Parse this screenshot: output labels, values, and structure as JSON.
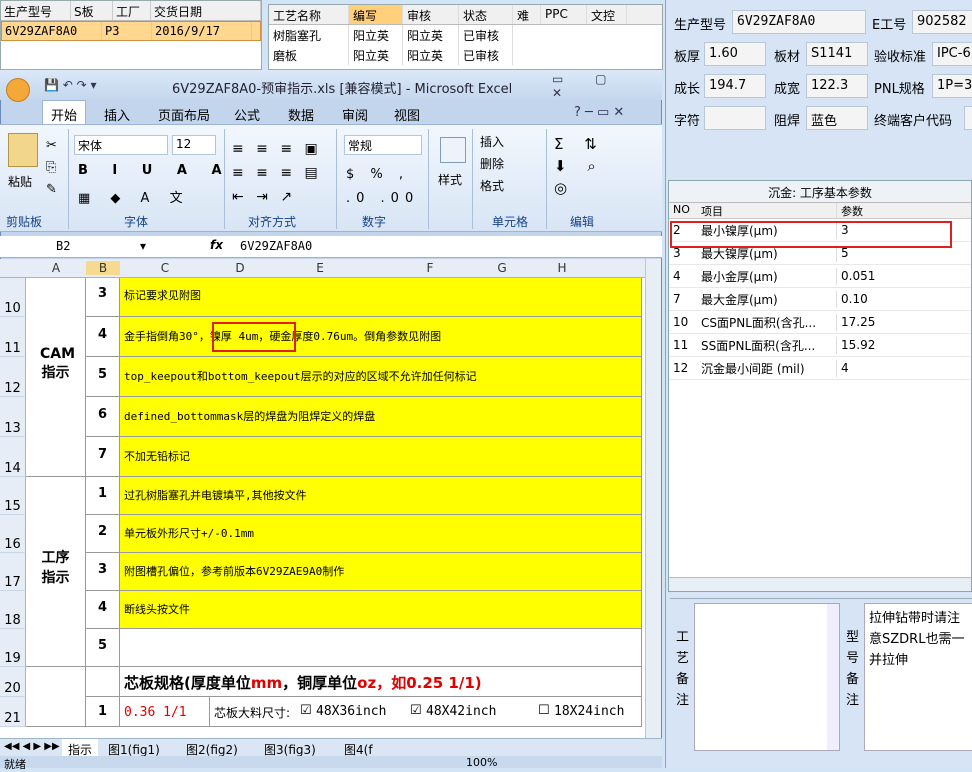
{
  "top_left": {
    "headers": [
      "生产型号",
      "S板",
      "工厂",
      "交货日期"
    ],
    "row": [
      "6V29ZAF8A0",
      "P3",
      "2016/9/17"
    ]
  },
  "top_mid": {
    "headers": [
      "工艺名称",
      "编写",
      "审核",
      "状态",
      "难",
      "PPC",
      "文控"
    ],
    "rows": [
      [
        "树脂塞孔",
        "阳立英",
        "阳立英",
        "已审核"
      ],
      [
        "磨板",
        "阳立英",
        "阳立英",
        "已审核"
      ]
    ]
  },
  "right": {
    "labels": {
      "model": "生产型号",
      "e": "E工号",
      "thick": "板厚",
      "mat": "板材",
      "std": "验收标准",
      "len": "成长",
      "wid": "成宽",
      "pnl": "PNL规格",
      "char": "字符",
      "mask": "阻焊",
      "cust": "终端客户代码"
    },
    "values": {
      "model": "6V29ZAF8A0",
      "e": "902582",
      "thick": "1.60",
      "mat": "S1141",
      "std": "IPC-6",
      "len": "194.7",
      "wid": "122.3",
      "pnl": "1P=3",
      "char": "",
      "mask": "蓝色",
      "cust": ""
    },
    "param_title": "沉金: 工序基本参数",
    "param_headers": [
      "NO",
      "项目",
      "参数"
    ],
    "params": [
      [
        "2",
        "最小镍厚(μm)",
        "3"
      ],
      [
        "3",
        "最大镍厚(μm)",
        "5"
      ],
      [
        "4",
        "最小金厚(μm)",
        "0.051"
      ],
      [
        "7",
        "最大金厚(μm)",
        "0.10"
      ],
      [
        "10",
        "CS面PNL面积(含孔...",
        "17.25"
      ],
      [
        "11",
        "SS面PNL面积(含孔...",
        "15.92"
      ],
      [
        "12",
        "沉金最小间距 (mil)",
        "4"
      ]
    ],
    "craft_note_label": "工艺备注",
    "model_note_label": "型号备注",
    "model_note": "拉伸钻带时请注意SZDRL也需一并拉伸"
  },
  "excel": {
    "title": "6V29ZAF8A0-预审指示.xls [兼容模式] - Microsoft Excel",
    "tabs": [
      "开始",
      "插入",
      "页面布局",
      "公式",
      "数据",
      "审阅",
      "视图"
    ],
    "font_name": "宋体",
    "font_size": "12",
    "number_format": "常规",
    "groups": [
      "剪贴板",
      "字体",
      "对齐方式",
      "数字",
      "样式",
      "单元格",
      "编辑"
    ],
    "btn": {
      "paste": "粘贴",
      "insert": "插入",
      "delete": "删除",
      "format": "格式",
      "style": "样式"
    },
    "name_box": "B2",
    "formula": "6V29ZAF8A0",
    "cols": [
      "A",
      "B",
      "C",
      "D",
      "E",
      "F",
      "G",
      "H"
    ],
    "row_nums": [
      "10",
      "11",
      "12",
      "13",
      "14",
      "15",
      "16",
      "17",
      "18",
      "19",
      "20",
      "21"
    ],
    "cam_label": "CAM指示",
    "proc_label": "工序指示",
    "cam_rows": [
      [
        "3",
        "标记要求见附图"
      ],
      [
        "4",
        "金手指倒角30°，镍厚 4um，硬金厚度0.76um。倒角参数见附图"
      ],
      [
        "5",
        "top_keepout和bottom_keepout层示的对应的区域不允许加任何标记"
      ],
      [
        "6",
        "defined_bottommask层的焊盘为阻焊定义的焊盘"
      ],
      [
        "7",
        "不加无铅标记"
      ]
    ],
    "proc_rows": [
      [
        "1",
        "过孔树脂塞孔并电镀填平,其他按文件"
      ],
      [
        "2",
        "单元板外形尺寸+/-0.1mm"
      ],
      [
        "3",
        "附图槽孔偏位，参考前版本6V29ZAE9A0制作"
      ],
      [
        "4",
        "断线头按文件"
      ],
      [
        "5",
        ""
      ]
    ],
    "core_title_a": "芯板规格(厚度单位",
    "core_title_mm": "mm",
    "core_title_b": "，铜厚单位",
    "core_title_oz": "oz",
    "core_title_c": "，如0.25 1/1)",
    "core_row_num": "1",
    "core_val": "0.36 1/1",
    "core_label": "芯板大料尺寸:",
    "opt1": "48X36inch",
    "opt2": "48X42inch",
    "opt3": "18X24inch",
    "sheet_tabs": [
      "指示",
      "图1(fig1)",
      "图2(fig2)",
      "图3(fig3)",
      "图4(f"
    ],
    "status": "就绪",
    "zoom": "100%"
  }
}
